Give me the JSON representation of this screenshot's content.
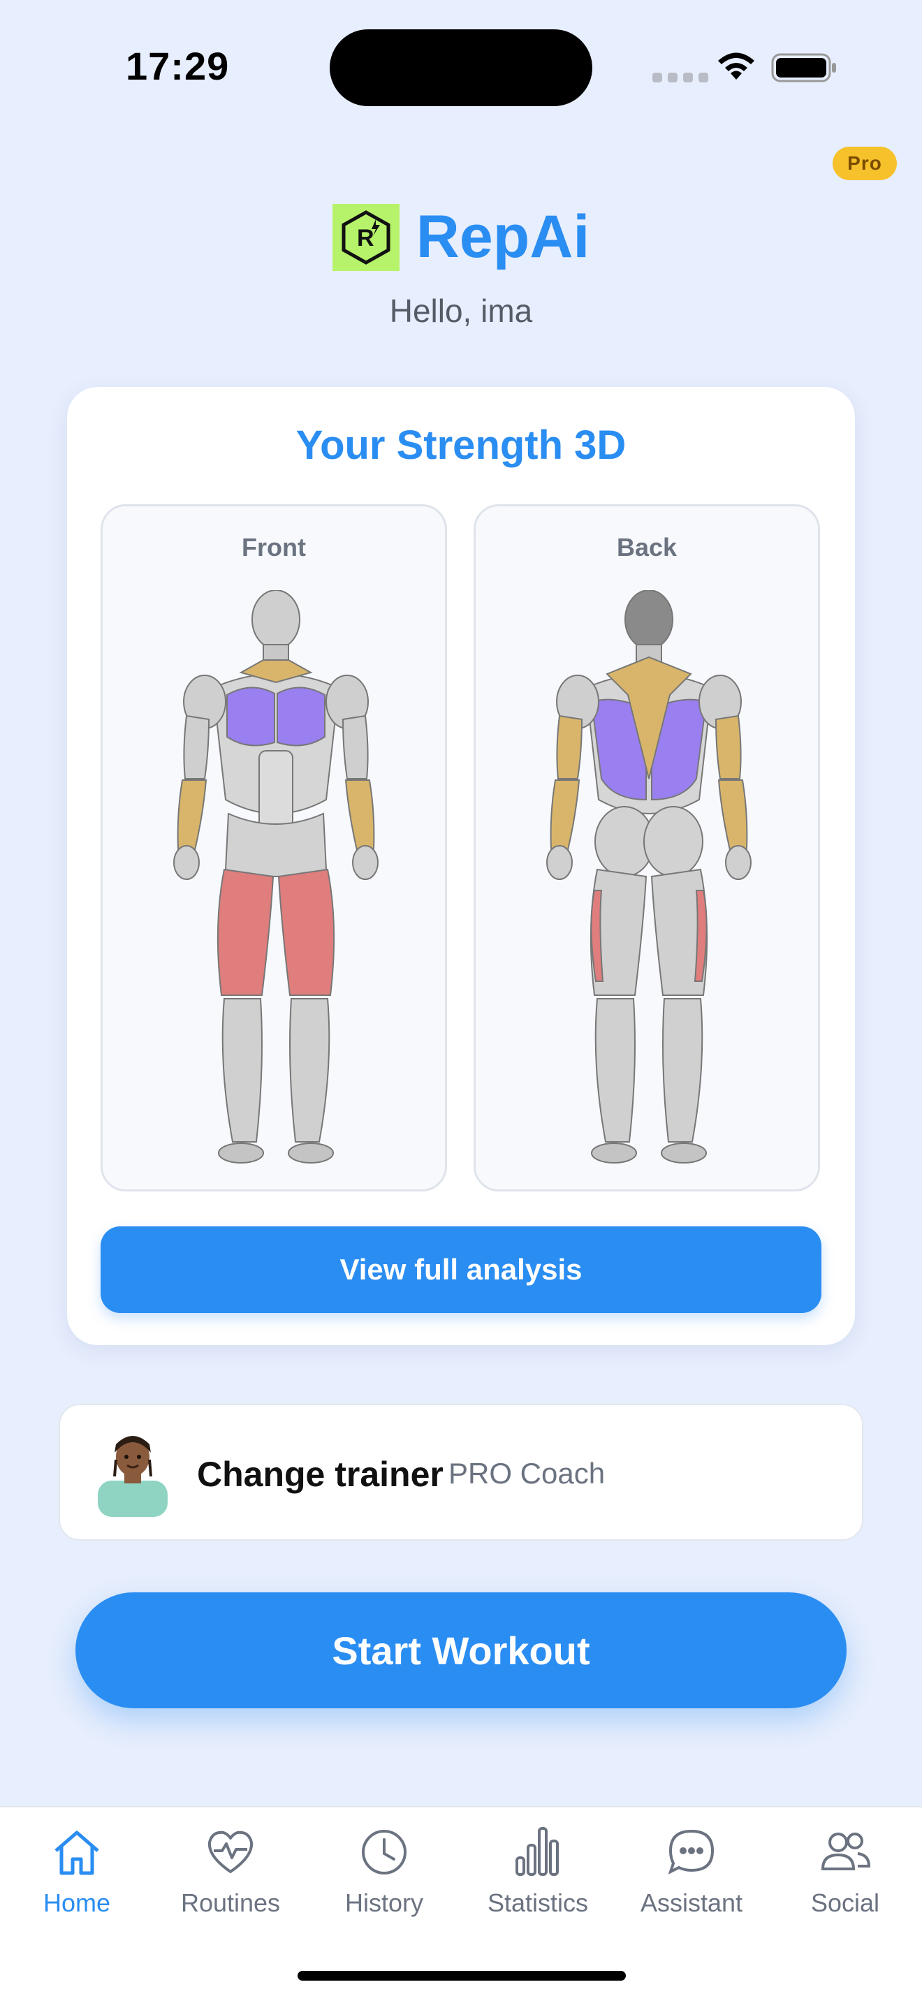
{
  "status_bar": {
    "time": "17:29"
  },
  "badge": {
    "label": "Pro"
  },
  "header": {
    "app_name": "RepAi",
    "greeting": "Hello, ima"
  },
  "strength_card": {
    "title": "Your Strength 3D",
    "front_label": "Front",
    "back_label": "Back",
    "button_label": "View full analysis"
  },
  "trainer": {
    "label": "Change trainer",
    "subtitle": "PRO Coach"
  },
  "start_button": {
    "label": "Start Workout"
  },
  "tab_bar": {
    "items": [
      {
        "label": "Home",
        "icon": "home-icon",
        "active": true
      },
      {
        "label": "Routines",
        "icon": "heart-pulse-icon",
        "active": false
      },
      {
        "label": "History",
        "icon": "clock-icon",
        "active": false
      },
      {
        "label": "Statistics",
        "icon": "bar-chart-icon",
        "active": false
      },
      {
        "label": "Assistant",
        "icon": "chat-bubble-icon",
        "active": false
      },
      {
        "label": "Social",
        "icon": "people-icon",
        "active": false
      }
    ]
  },
  "colors": {
    "accent": "#2a8df2",
    "background": "#e7eefd",
    "pro_badge": "#f6c12a",
    "logo_bg": "#b6f36a",
    "chest_lats": "#9a7ff0",
    "shoulders_arms": "#d8b56a",
    "quads_hamstrings": "#e07d7d"
  }
}
